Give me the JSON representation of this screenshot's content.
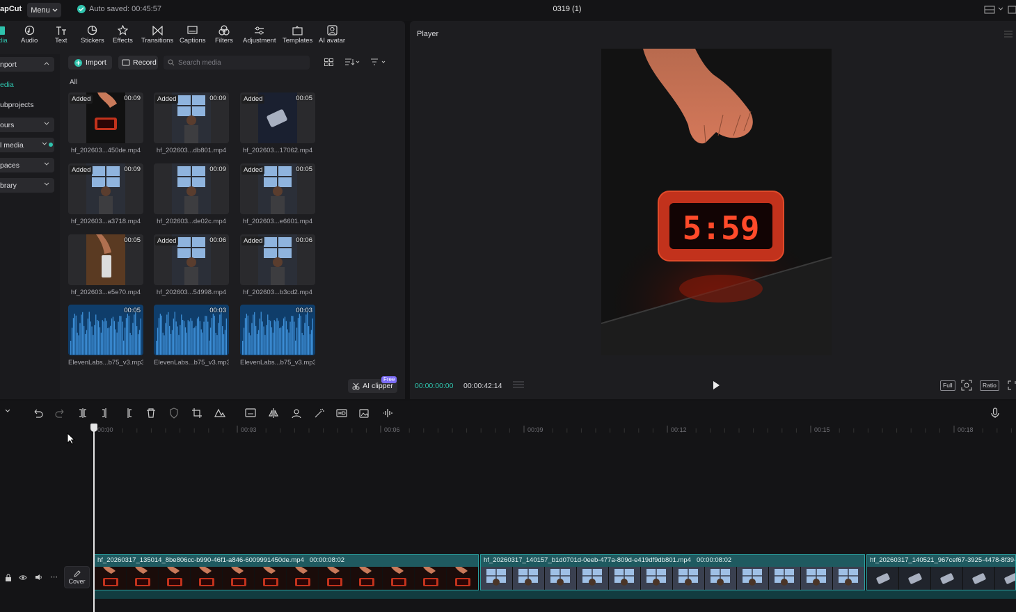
{
  "app": {
    "brand": "apCut",
    "menu_label": "Menu",
    "autosave": "Auto saved: 00:45:57",
    "project_title": "0319 (1)"
  },
  "tools": [
    {
      "label": "dia",
      "icon": "media-icon",
      "active": true
    },
    {
      "label": "Audio",
      "icon": "audio-icon"
    },
    {
      "label": "Text",
      "icon": "text-icon"
    },
    {
      "label": "Stickers",
      "icon": "stickers-icon"
    },
    {
      "label": "Effects",
      "icon": "effects-icon"
    },
    {
      "label": "Transitions",
      "icon": "transitions-icon"
    },
    {
      "label": "Captions",
      "icon": "captions-icon"
    },
    {
      "label": "Filters",
      "icon": "filters-icon"
    },
    {
      "label": "Adjustment",
      "icon": "adjustment-icon"
    },
    {
      "label": "Templates",
      "icon": "templates-icon"
    },
    {
      "label": "AI avatar",
      "icon": "ai-avatar-icon"
    }
  ],
  "sidebar": {
    "items": [
      {
        "label": "nport",
        "chevron": "up"
      },
      {
        "label": "edia",
        "active": true
      },
      {
        "label": "ubprojects"
      },
      {
        "label": "ours",
        "chevron": "down"
      },
      {
        "label": "l media",
        "chevron": "down",
        "dot": true
      },
      {
        "label": "paces",
        "chevron": "down"
      },
      {
        "label": "brary",
        "chevron": "down"
      }
    ]
  },
  "media": {
    "import_label": "Import",
    "record_label": "Record",
    "search_placeholder": "Search media",
    "filter_label": "All",
    "ai_clipper_label": "AI clipper",
    "free_badge": "Free",
    "items": [
      {
        "name": "hf_202603...450de.mp4",
        "duration": "00:09",
        "added": "Added",
        "kind": "clock"
      },
      {
        "name": "hf_202603...db801.mp4",
        "duration": "00:09",
        "added": "Added",
        "kind": "window"
      },
      {
        "name": "hf_202603...17062.mp4",
        "duration": "00:05",
        "added": "Added",
        "kind": "dark"
      },
      {
        "name": "hf_202603...a3718.mp4",
        "duration": "00:09",
        "added": "Added",
        "kind": "window"
      },
      {
        "name": "hf_202603...de02c.mp4",
        "duration": "00:09",
        "added": "",
        "kind": "window"
      },
      {
        "name": "hf_202603...e6601.mp4",
        "duration": "00:05",
        "added": "Added",
        "kind": "window"
      },
      {
        "name": "hf_202603...e5e70.mp4",
        "duration": "00:05",
        "added": "",
        "kind": "warm"
      },
      {
        "name": "hf_202603...54998.mp4",
        "duration": "00:06",
        "added": "Added",
        "kind": "window"
      },
      {
        "name": "hf_202603...b3cd2.mp4",
        "duration": "00:06",
        "added": "Added",
        "kind": "window"
      },
      {
        "name": "ElevenLabs...b75_v3.mp3",
        "duration": "00:05",
        "added": "",
        "kind": "audio"
      },
      {
        "name": "ElevenLabs...b75_v3.mp3",
        "duration": "00:03",
        "added": "",
        "kind": "audio"
      },
      {
        "name": "ElevenLabs...b75_v3.mp3",
        "duration": "00:03",
        "added": "",
        "kind": "audio"
      }
    ]
  },
  "player": {
    "title": "Player",
    "clock_display": "5:59",
    "timecode_current": "00:00:00:00",
    "timecode_total": "00:00:42:14",
    "buttons": {
      "full": "Full",
      "ratio": "Ratio"
    }
  },
  "timeline": {
    "ruler_labels": [
      "00:00",
      "00:03",
      "00:06",
      "00:09",
      "00:12",
      "00:15",
      "00:18"
    ],
    "cover_label": "Cover",
    "clips": [
      {
        "name": "hf_20260317_135014_8be806cc-b990-46f1-a846-6009991450de.mp4",
        "duration": "00:00:08:02",
        "kind": "clock"
      },
      {
        "name": "hf_20260317_140157_b1d0701d-0eeb-477a-809d-e419df9db801.mp4",
        "duration": "00:00:08:02",
        "kind": "window"
      },
      {
        "name": "hf_20260317_140521_967cef67-3925-4478-8f39-4",
        "duration": "",
        "kind": "dark"
      }
    ]
  },
  "colors": {
    "accent": "#2fc3ad",
    "clip": "#1f5a60",
    "audio_wave": "#1f6fb5"
  }
}
